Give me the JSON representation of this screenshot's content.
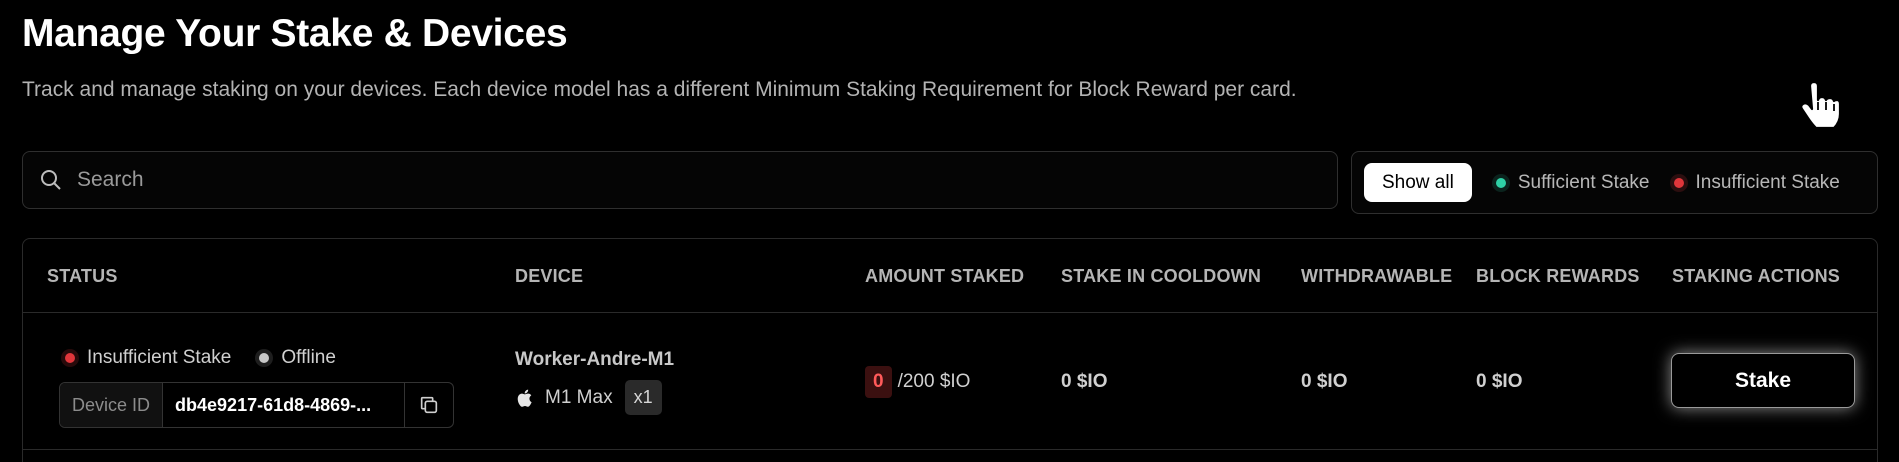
{
  "header": {
    "title": "Manage Your Stake & Devices",
    "subtitle": "Track and manage staking on your devices. Each device model has a different Minimum Staking Requirement for Block Reward per card."
  },
  "search": {
    "placeholder": "Search",
    "value": "",
    "icon": "search-icon"
  },
  "filters": {
    "show_all": "Show all",
    "sufficient": "Sufficient Stake",
    "insufficient": "Insufficient Stake",
    "colors": {
      "sufficient": "#2fd1a6",
      "insufficient": "#e0363b"
    }
  },
  "table": {
    "headers": {
      "status": "STATUS",
      "device": "DEVICE",
      "amount_staked": "AMOUNT STAKED",
      "cooldown": "STAKE IN COOLDOWN",
      "withdrawable": "WITHDRAWABLE",
      "block_rewards": "BLOCK REWARDS",
      "actions": "STAKING ACTIONS"
    },
    "rows": [
      {
        "stake_status": "Insufficient Stake",
        "online_status": "Offline",
        "device_id_label": "Device ID",
        "device_id": "db4e9217-61d8-4869-...",
        "device_name": "Worker-Andre-M1",
        "device_model": "M1 Max",
        "device_count": "x1",
        "amount_current": "0",
        "amount_required": "/200 $IO",
        "cooldown": "0 $IO",
        "withdrawable": "0 $IO",
        "block_rewards": "0 $IO",
        "action_label": "Stake"
      }
    ]
  }
}
